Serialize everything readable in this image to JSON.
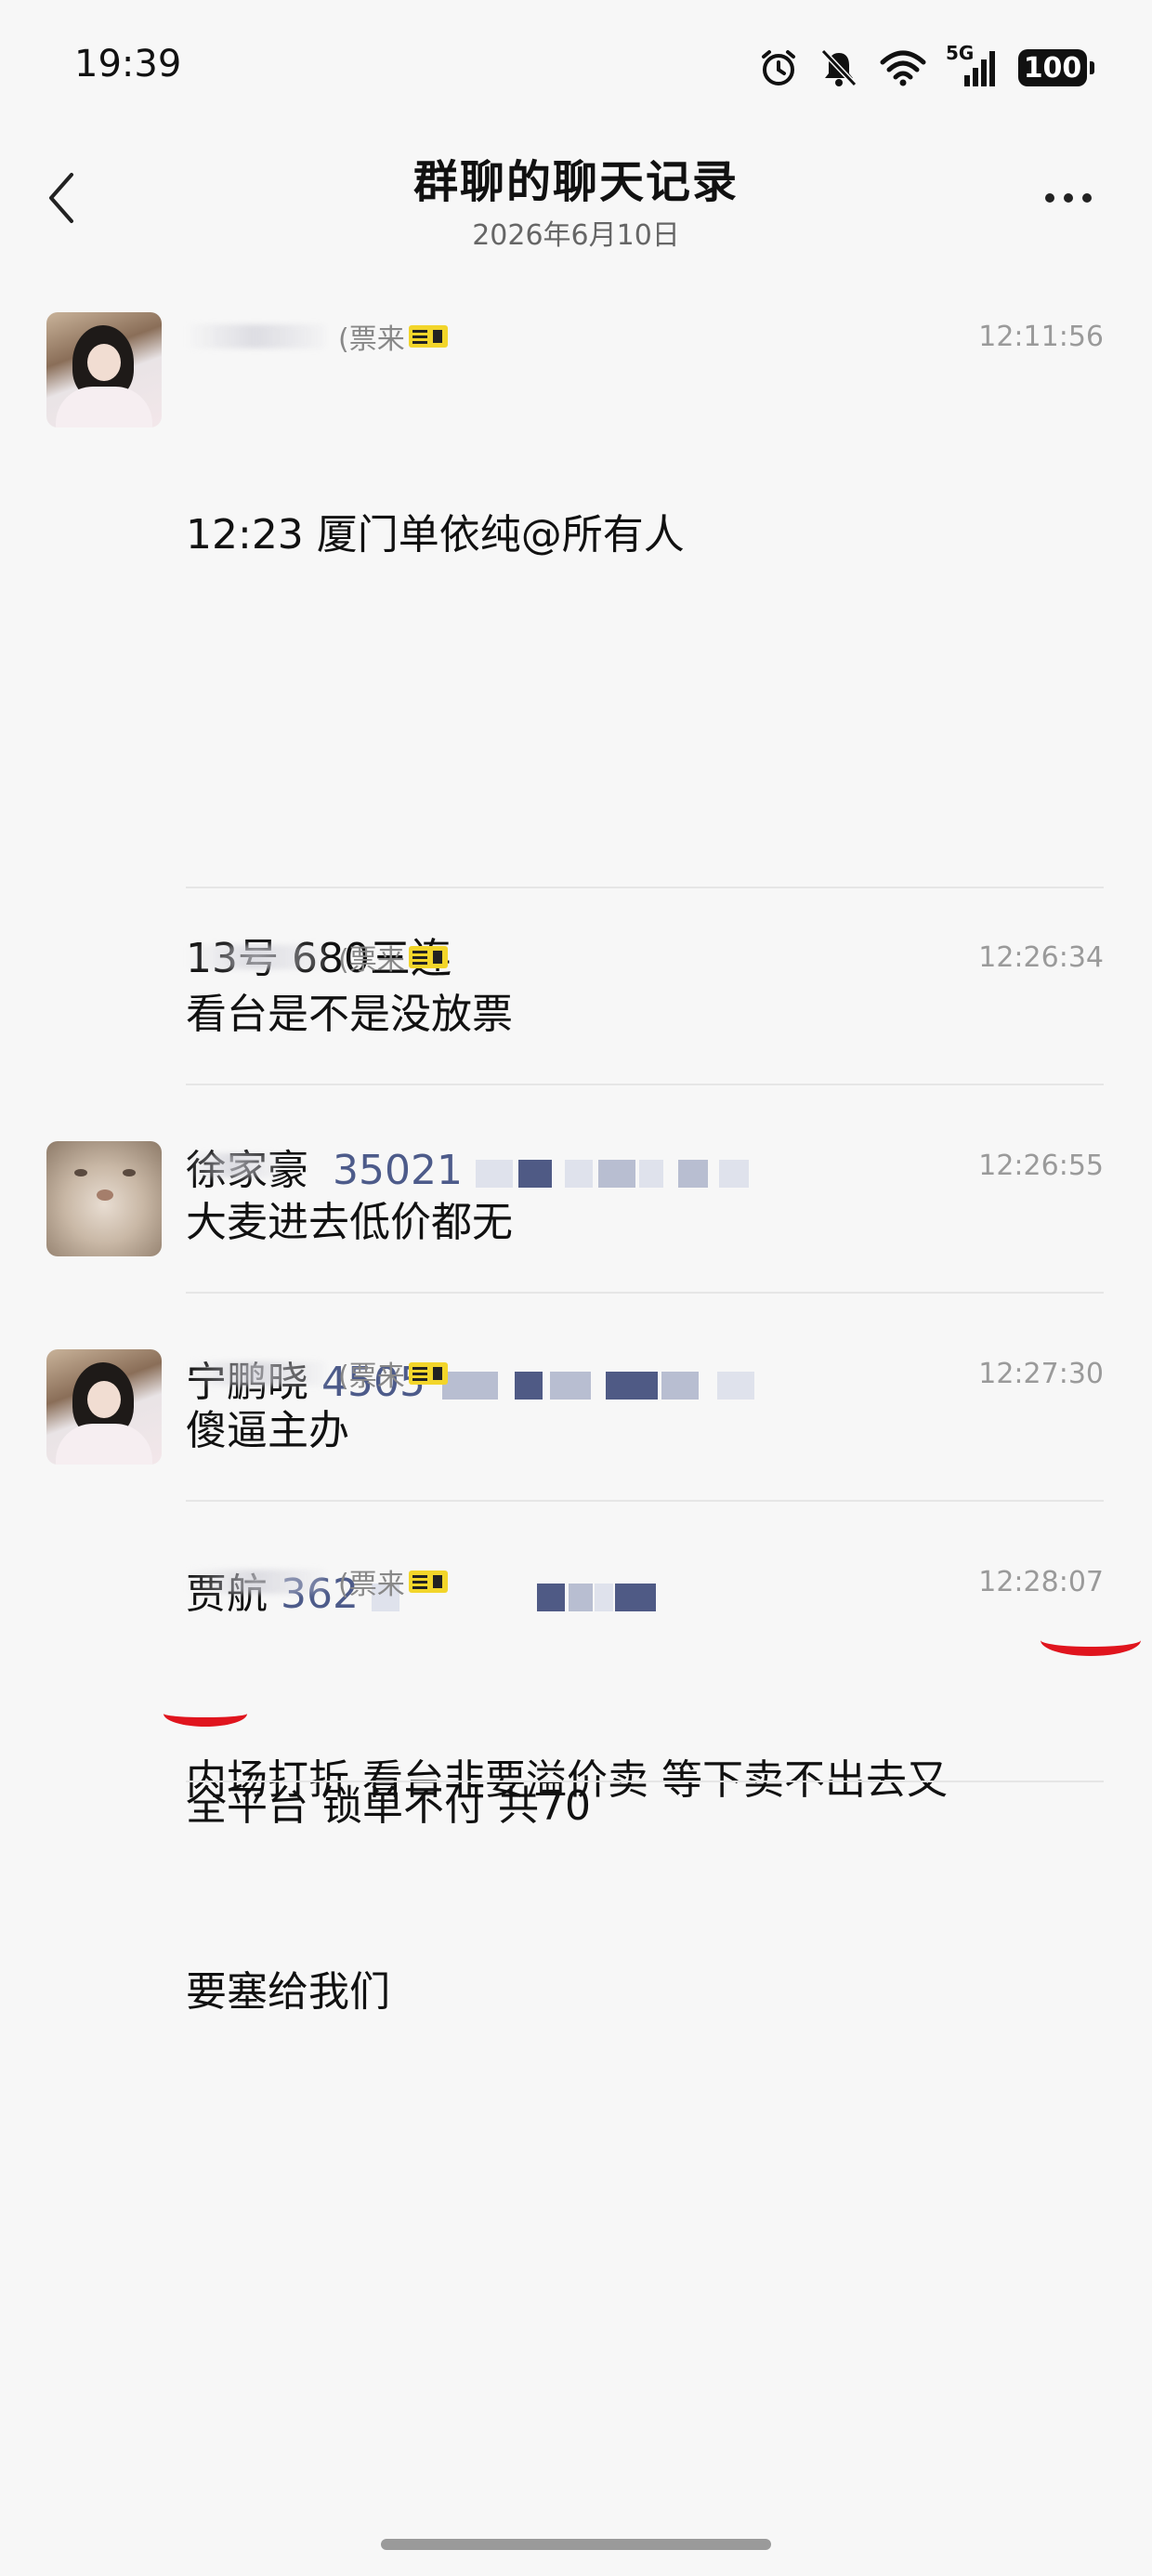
{
  "status_bar": {
    "time": "19:39",
    "network": "5G",
    "battery": "100",
    "icons": [
      "alarm-icon",
      "mute-icon",
      "wifi-icon",
      "signal-icon",
      "battery-icon"
    ]
  },
  "header": {
    "title": "群聊的聊天记录",
    "date": "2026年6月10日",
    "back_icon": "chevron-left-icon",
    "more_icon": "more-dots-icon"
  },
  "messages": [
    {
      "sender_tag": "(票来",
      "time": "12:11:56",
      "lines": {
        "l1": "12:23 厦门单依纯@所有人",
        "l3": "13号 680三连",
        "l4_name": "徐家豪",
        "l4_num": "35021",
        "l5_name": "宁鹏晓",
        "l5_num": "4505",
        "l6_name": "贾航",
        "l6_num": "362",
        "l7": "全平台 锁单不付 共70"
      }
    },
    {
      "sender_tag": "(票来",
      "time": "12:26:34",
      "text": "看台是不是没放票"
    },
    {
      "sender_tag": "",
      "time": "12:26:55",
      "text": "大麦进去低价都无"
    },
    {
      "sender_tag": "(票来",
      "time": "12:27:30",
      "text": "傻逼主办"
    },
    {
      "sender_tag": "(票来",
      "time": "12:28:07",
      "line1": "内场打折 看台非要溢价卖 等下卖不出去又",
      "line2": "要塞给我们"
    }
  ],
  "colors": {
    "background": "#f7f7f7",
    "redacted_text": "#4d5b8a",
    "annotation_red": "#e0151e",
    "badge_yellow": "#f2d52a"
  }
}
